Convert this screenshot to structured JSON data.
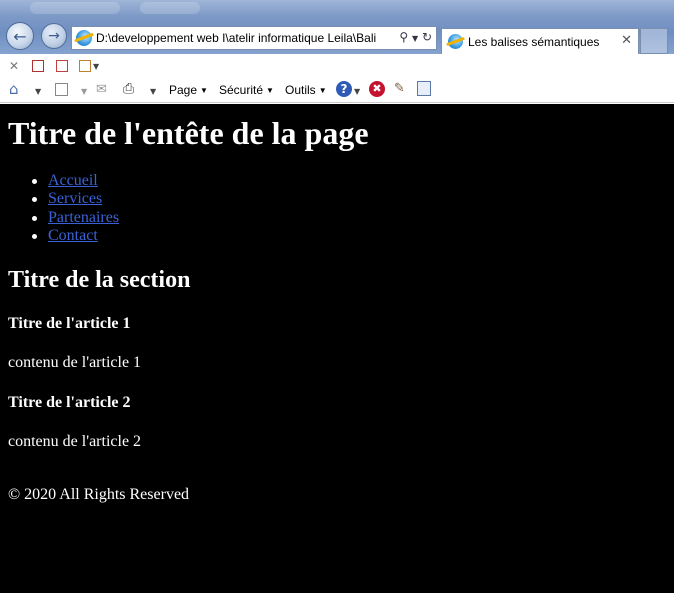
{
  "browser": {
    "address_url": "D:\\developpement web I\\atelir informatique Leila\\Bali",
    "tab_title": "Les balises sémantiques",
    "menus": {
      "page": "Page",
      "securite": "Sécurité",
      "outils": "Outils"
    },
    "icons": [
      "back-arrow-icon",
      "forward-arrow-icon",
      "ie-logo-icon",
      "search-icon",
      "refresh-icon",
      "close-tab-icon",
      "home-icon",
      "rss-feed-icon",
      "mail-icon",
      "print-icon",
      "help-icon",
      "stop-icon",
      "research-icon",
      "compatibility-icon"
    ]
  },
  "page": {
    "header_title": "Titre de l'entête de la page",
    "nav": [
      "Accueil",
      "Services",
      "Partenaires",
      "Contact"
    ],
    "section_title": "Titre de la section",
    "articles": [
      {
        "title": "Titre de l'article 1",
        "content": "contenu de l'article 1"
      },
      {
        "title": "Titre de l'article 2",
        "content": "contenu de l'article 2"
      }
    ],
    "footer": "© 2020 All Rights Reserved"
  },
  "colors": {
    "page_background": "#000000",
    "text": "#ffffff",
    "link": "#3a62d6",
    "titlebar": "#7d99c6"
  }
}
